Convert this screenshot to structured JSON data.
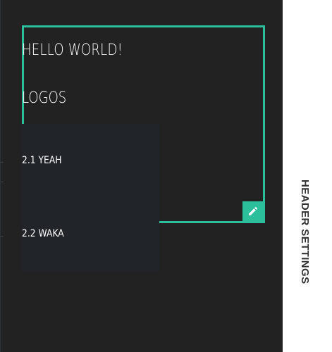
{
  "header": {
    "title": "HELLO WORLD!",
    "menu_label": "LOGOS"
  },
  "submenu": {
    "items": [
      {
        "label": "2.1 YEAH"
      },
      {
        "label": "2.2 WAKA"
      }
    ]
  },
  "edit_button": {
    "icon": "pencil-icon"
  },
  "sidebar": {
    "label": "HEADER SETTINGS"
  },
  "colors": {
    "background": "#222222",
    "accent": "#2bbf9c",
    "submenu_background": "#212529",
    "panel": "#ffffff",
    "panel_text": "#333333"
  }
}
